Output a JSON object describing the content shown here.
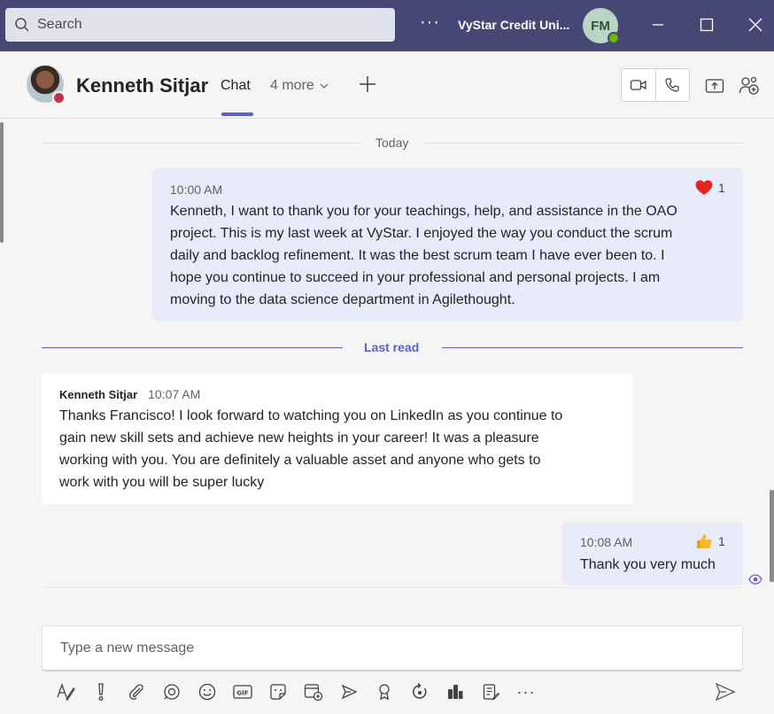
{
  "titlebar": {
    "search_placeholder": "Search",
    "more_label": "···",
    "org_name": "VyStar Credit Uni...",
    "user_initials": "FM",
    "colors": {
      "bar": "#464775",
      "search_bg": "#e1e1ec",
      "presence": "#6bb700"
    }
  },
  "chat_header": {
    "contact_name": "Kenneth Sitjar",
    "contact_presence": "busy",
    "tabs": {
      "chat": "Chat",
      "more": "4 more"
    },
    "accent": "#5b5fc7"
  },
  "conversation": {
    "date_divider": "Today",
    "last_read_label": "Last read",
    "messages": [
      {
        "from": "me",
        "time": "10:00 AM",
        "reaction": {
          "icon": "heart-icon",
          "count": "1"
        },
        "lines": [
          "Kenneth, I want to thank you for your teachings, help, and assistance in the OAO",
          "project. This is my last week at VyStar. I enjoyed the way you conduct the scrum",
          "daily and backlog refinement. It was the best scrum team I have ever been to. I",
          "hope you continue to succeed in your professional and personal projects. I am",
          "moving to the data science department in Agilethought."
        ]
      },
      {
        "from": "other",
        "sender": "Kenneth Sitjar",
        "time": "10:07 AM",
        "lines": [
          "Thanks Francisco! I look forward to watching you on LinkedIn as you continue to",
          "gain new skill sets and achieve new heights in your career! It was a pleasure",
          "working with you. You are definitely a valuable asset and anyone who gets to",
          "work with you will be super lucky"
        ]
      },
      {
        "from": "me",
        "time": "10:08 AM",
        "reaction": {
          "icon": "thumbs-up-icon",
          "count": "1"
        },
        "lines": [
          "Thank you very much"
        ]
      }
    ]
  },
  "compose": {
    "placeholder": "Type a new message",
    "toolbar_icons": [
      "format-icon",
      "important-icon",
      "attach-icon",
      "loop-icon",
      "emoji-icon",
      "gif-icon",
      "sticker-icon",
      "schedule-meeting-icon",
      "stream-icon",
      "praise-icon",
      "loop-refresh-icon",
      "app-icon",
      "forms-icon",
      "more-icon"
    ],
    "more_label": "···"
  }
}
